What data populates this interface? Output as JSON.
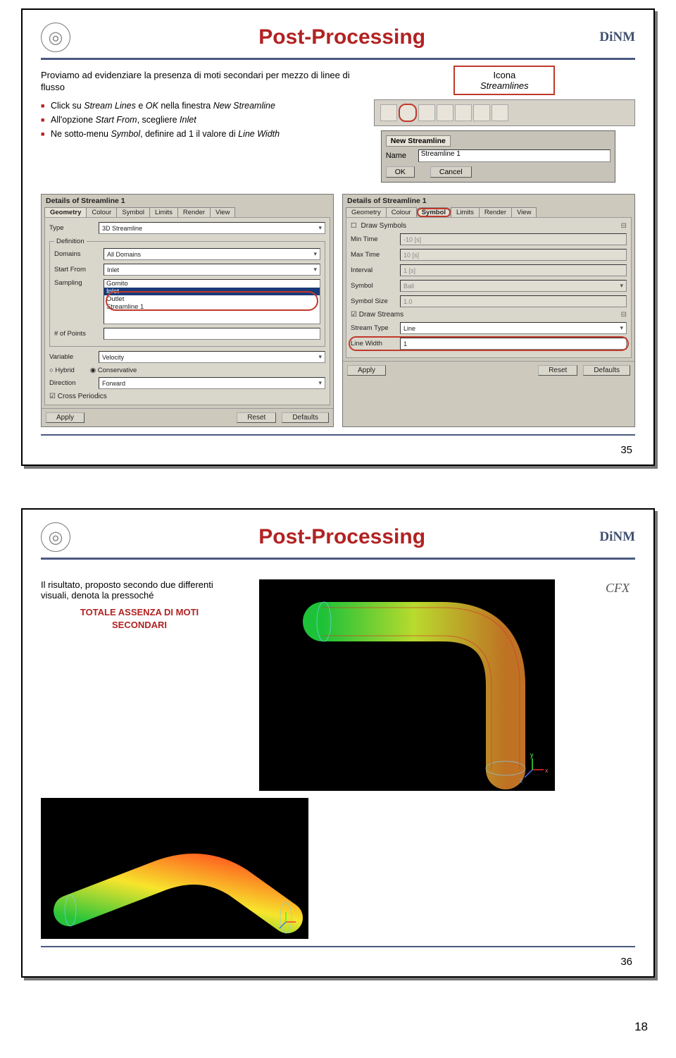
{
  "page_number": "18",
  "slide1": {
    "number": "35",
    "title": "Post-Processing",
    "logo_text": "DiNM",
    "intro": "Proviamo ad evidenziare la presenza di moti secondari per mezzo di linee di flusso",
    "bullets": [
      {
        "pre": "Click su ",
        "i1": "Stream Lines",
        "mid": " e ",
        "i2": "OK",
        "post": " nella finestra ",
        "i3": "New Streamline"
      },
      {
        "pre": "All'opzione ",
        "i1": "Start From",
        "mid": ", scegliere ",
        "i2": "Inlet",
        "post": "",
        "i3": ""
      },
      {
        "pre": "Ne sotto-menu ",
        "i1": "Symbol",
        "mid": ", definire ad 1 il valore di ",
        "i2": "Line Width",
        "post": "",
        "i3": ""
      }
    ],
    "callout": {
      "line1": "Icona",
      "line2": "Streamlines"
    },
    "newstream": {
      "header": "New Streamline",
      "name_label": "Name",
      "name_value": "Streamline 1",
      "ok": "OK",
      "cancel": "Cancel"
    },
    "panelA": {
      "title": "Details of Streamline 1",
      "tabs": [
        "Geometry",
        "Colour",
        "Symbol",
        "Limits",
        "Render",
        "View"
      ],
      "active_tab": "Geometry",
      "type_label": "Type",
      "type_value": "3D Streamline",
      "definition": "Definition",
      "domains_label": "Domains",
      "domains_value": "All Domains",
      "startfrom_label": "Start From",
      "startfrom_value": "Inlet",
      "list": [
        "Gomito",
        "Inlet",
        "Outlet",
        "Streamline 1"
      ],
      "sampling_label": "Sampling",
      "points_label": "# of Points",
      "variable_label": "Variable",
      "variable_value": "Velocity",
      "hybrid": "Hybrid",
      "conservative": "Conservative",
      "direction_label": "Direction",
      "direction_value": "Forward",
      "cross": "Cross Periodics",
      "apply": "Apply",
      "reset": "Reset",
      "defaults": "Defaults"
    },
    "panelB": {
      "title": "Details of Streamline 1",
      "tabs": [
        "Geometry",
        "Colour",
        "Symbol",
        "Limits",
        "Render",
        "View"
      ],
      "active_tab": "Symbol",
      "draw_symbols": "Draw Symbols",
      "mintime_label": "Min Time",
      "mintime_value": "-10 [s]",
      "maxtime_label": "Max Time",
      "maxtime_value": "10 [s]",
      "interval_label": "Interval",
      "interval_value": "1 [s]",
      "symbol_label": "Symbol",
      "symbol_value": "Ball",
      "symsize_label": "Symbol Size",
      "symsize_value": "1.0",
      "draw_streams": "Draw Streams",
      "stype_label": "Stream Type",
      "stype_value": "Line",
      "lwidth_label": "Line Width",
      "lwidth_value": "1",
      "apply": "Apply",
      "reset": "Reset",
      "defaults": "Defaults"
    }
  },
  "slide2": {
    "number": "36",
    "title": "Post-Processing",
    "logo_text": "DiNM",
    "cfx_label": "CFX",
    "result_text": "Il risultato, proposto secondo due differenti visuali, denota la pressoché",
    "result_emph1": "TOTALE ASSENZA DI MOTI",
    "result_emph2": "SECONDARI"
  }
}
